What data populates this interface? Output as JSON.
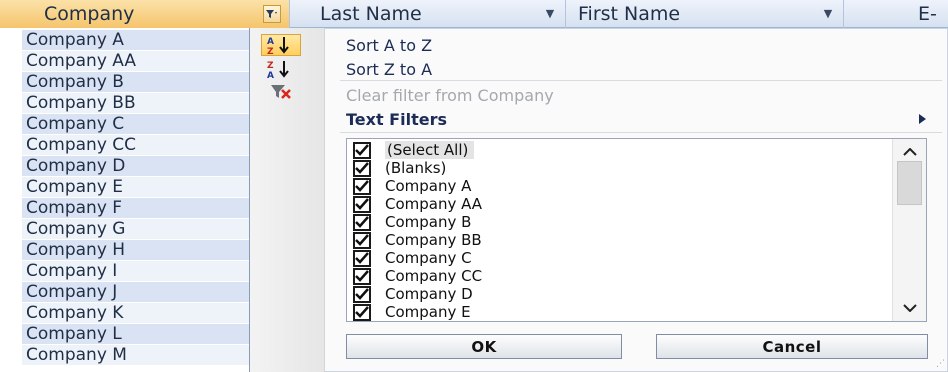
{
  "header": {
    "columns": [
      {
        "label": "Company",
        "filter_icon": "filter-active-icon"
      },
      {
        "label": "Last Name",
        "filter_icon": "dropdown-arrow-icon"
      },
      {
        "label": "First Name",
        "filter_icon": "dropdown-arrow-icon"
      },
      {
        "label": "E-"
      }
    ]
  },
  "cells": [
    "Company A",
    "Company AA",
    "Company B",
    "Company BB",
    "Company C",
    "Company CC",
    "Company D",
    "Company E",
    "Company F",
    "Company G",
    "Company H",
    "Company I",
    "Company J",
    "Company K",
    "Company L",
    "Company M"
  ],
  "menu": {
    "sort_az": "Sort A to Z",
    "sort_za": "Sort Z to A",
    "clear_filter": "Clear filter from Company",
    "text_filters": "Text Filters"
  },
  "checklist": {
    "items": [
      {
        "label": "(Select All)",
        "checked": true
      },
      {
        "label": "(Blanks)",
        "checked": true
      },
      {
        "label": "Company A",
        "checked": true
      },
      {
        "label": "Company AA",
        "checked": true
      },
      {
        "label": "Company B",
        "checked": true
      },
      {
        "label": "Company BB",
        "checked": true
      },
      {
        "label": "Company C",
        "checked": true
      },
      {
        "label": "Company CC",
        "checked": true
      },
      {
        "label": "Company D",
        "checked": true
      },
      {
        "label": "Company E",
        "checked": true
      }
    ]
  },
  "buttons": {
    "ok": "OK",
    "cancel": "Cancel"
  },
  "colors": {
    "header_active": "#f5c46c",
    "cell_fill": "#d9e3f3",
    "menu_text": "#1c2c56",
    "disabled_text": "#a5a8ae"
  }
}
